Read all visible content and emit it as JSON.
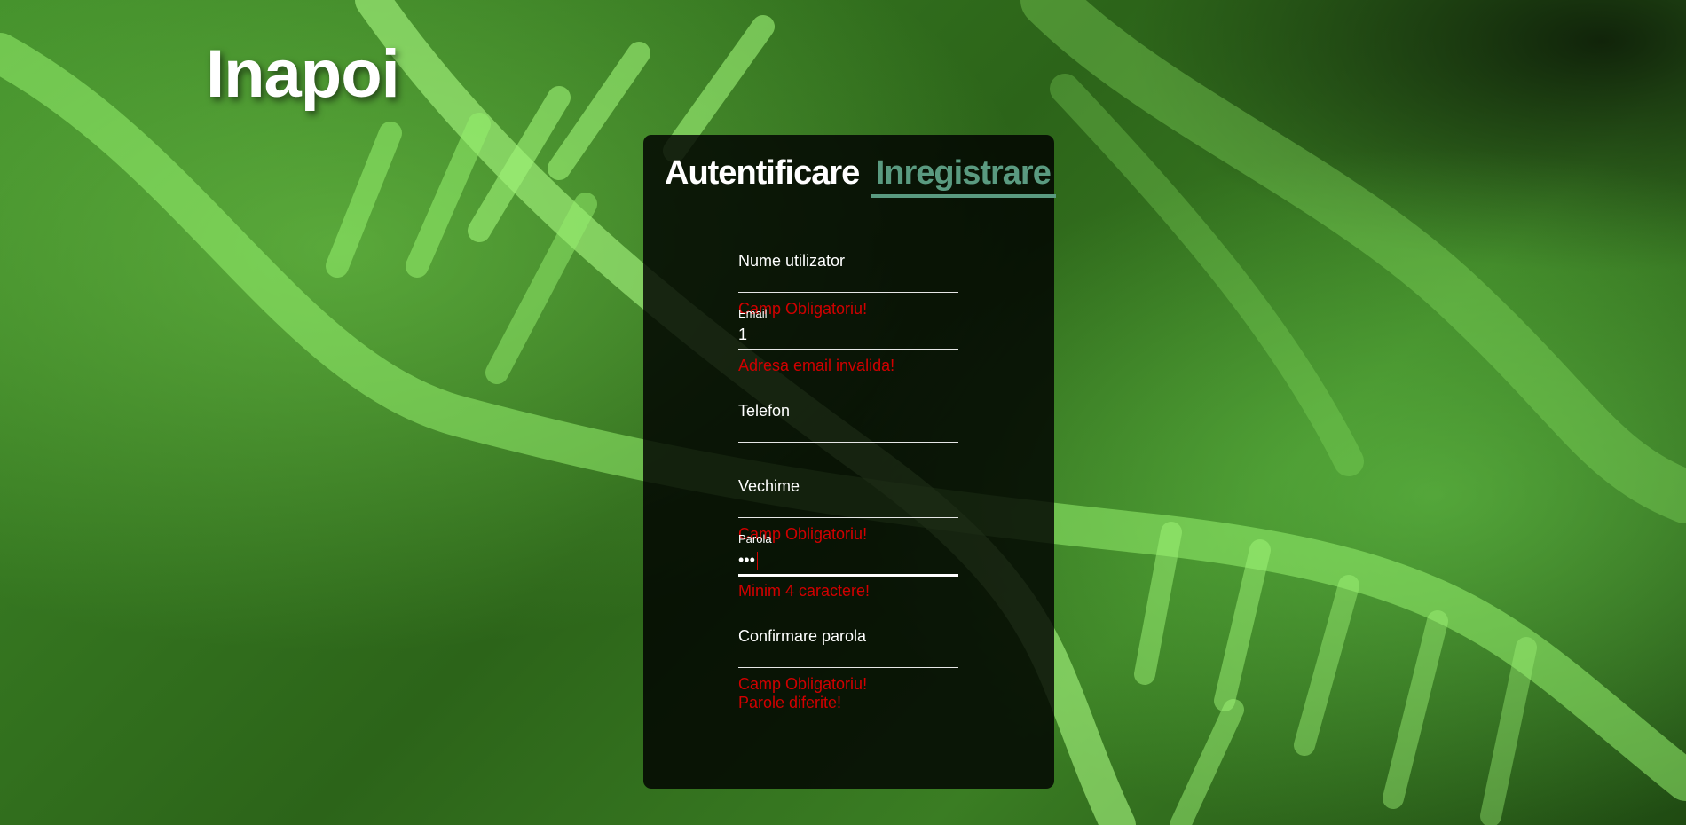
{
  "back_link": "Inapoi",
  "tabs": [
    {
      "label": "Autentificare",
      "active": false
    },
    {
      "label": "Inregistrare",
      "active": true
    }
  ],
  "form": {
    "username": {
      "label": "Nume utilizator",
      "value": "",
      "errors": [
        "Camp Obligatoriu!"
      ]
    },
    "email": {
      "label": "Email",
      "value": "1",
      "errors": [
        "Adresa email invalida!"
      ]
    },
    "phone": {
      "label": "Telefon",
      "value": "",
      "errors": []
    },
    "seniority": {
      "label": "Vechime",
      "value": "",
      "errors": [
        "Camp Obligatoriu!"
      ]
    },
    "password": {
      "label": "Parola",
      "value": "•••",
      "errors": [
        "Minim 4 caractere!"
      ]
    },
    "confirm_password": {
      "label": "Confirmare parola",
      "value": "",
      "errors": [
        "Camp Obligatoriu!",
        "Parole diferite!"
      ]
    }
  },
  "colors": {
    "accent": "#5a9a80",
    "error": "#d10000",
    "panel_bg": "rgba(0,0,0,0.82)",
    "background": "#2f6a1f"
  }
}
